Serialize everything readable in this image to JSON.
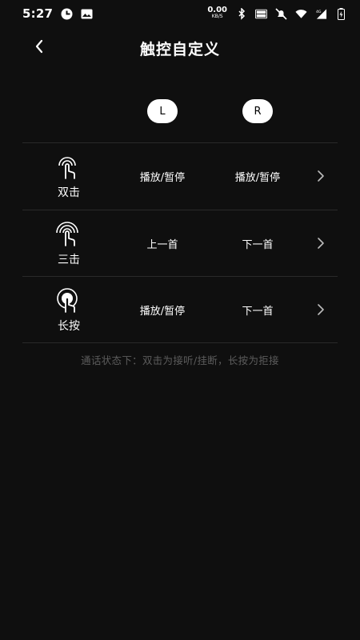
{
  "status_bar": {
    "time": "5:27",
    "net_speed_value": "0.00",
    "net_speed_unit": "KB/S",
    "icons": [
      "app-notification-icon",
      "image-icon",
      "bluetooth-icon",
      "volte-icon",
      "mute-icon",
      "wifi-icon",
      "signal-4g-icon",
      "battery-charging-icon"
    ]
  },
  "header": {
    "title": "触控自定义",
    "back_icon": "chevron-left-icon"
  },
  "channels": {
    "left": "L",
    "right": "R"
  },
  "gestures": [
    {
      "label": "双击",
      "left": "播放/暂停",
      "right": "播放/暂停",
      "icon": "double-tap-icon"
    },
    {
      "label": "三击",
      "left": "上一首",
      "right": "下一首",
      "icon": "triple-tap-icon"
    },
    {
      "label": "长按",
      "left": "播放/暂停",
      "right": "下一首",
      "icon": "long-press-icon"
    }
  ],
  "call_hint": "通话状态下：双击为接听/挂断，长按为拒接",
  "colors": {
    "background": "#0f0f0f",
    "divider": "#2a2a2a",
    "hint_text": "#5c5c5c",
    "pill_bg": "#ffffff"
  }
}
